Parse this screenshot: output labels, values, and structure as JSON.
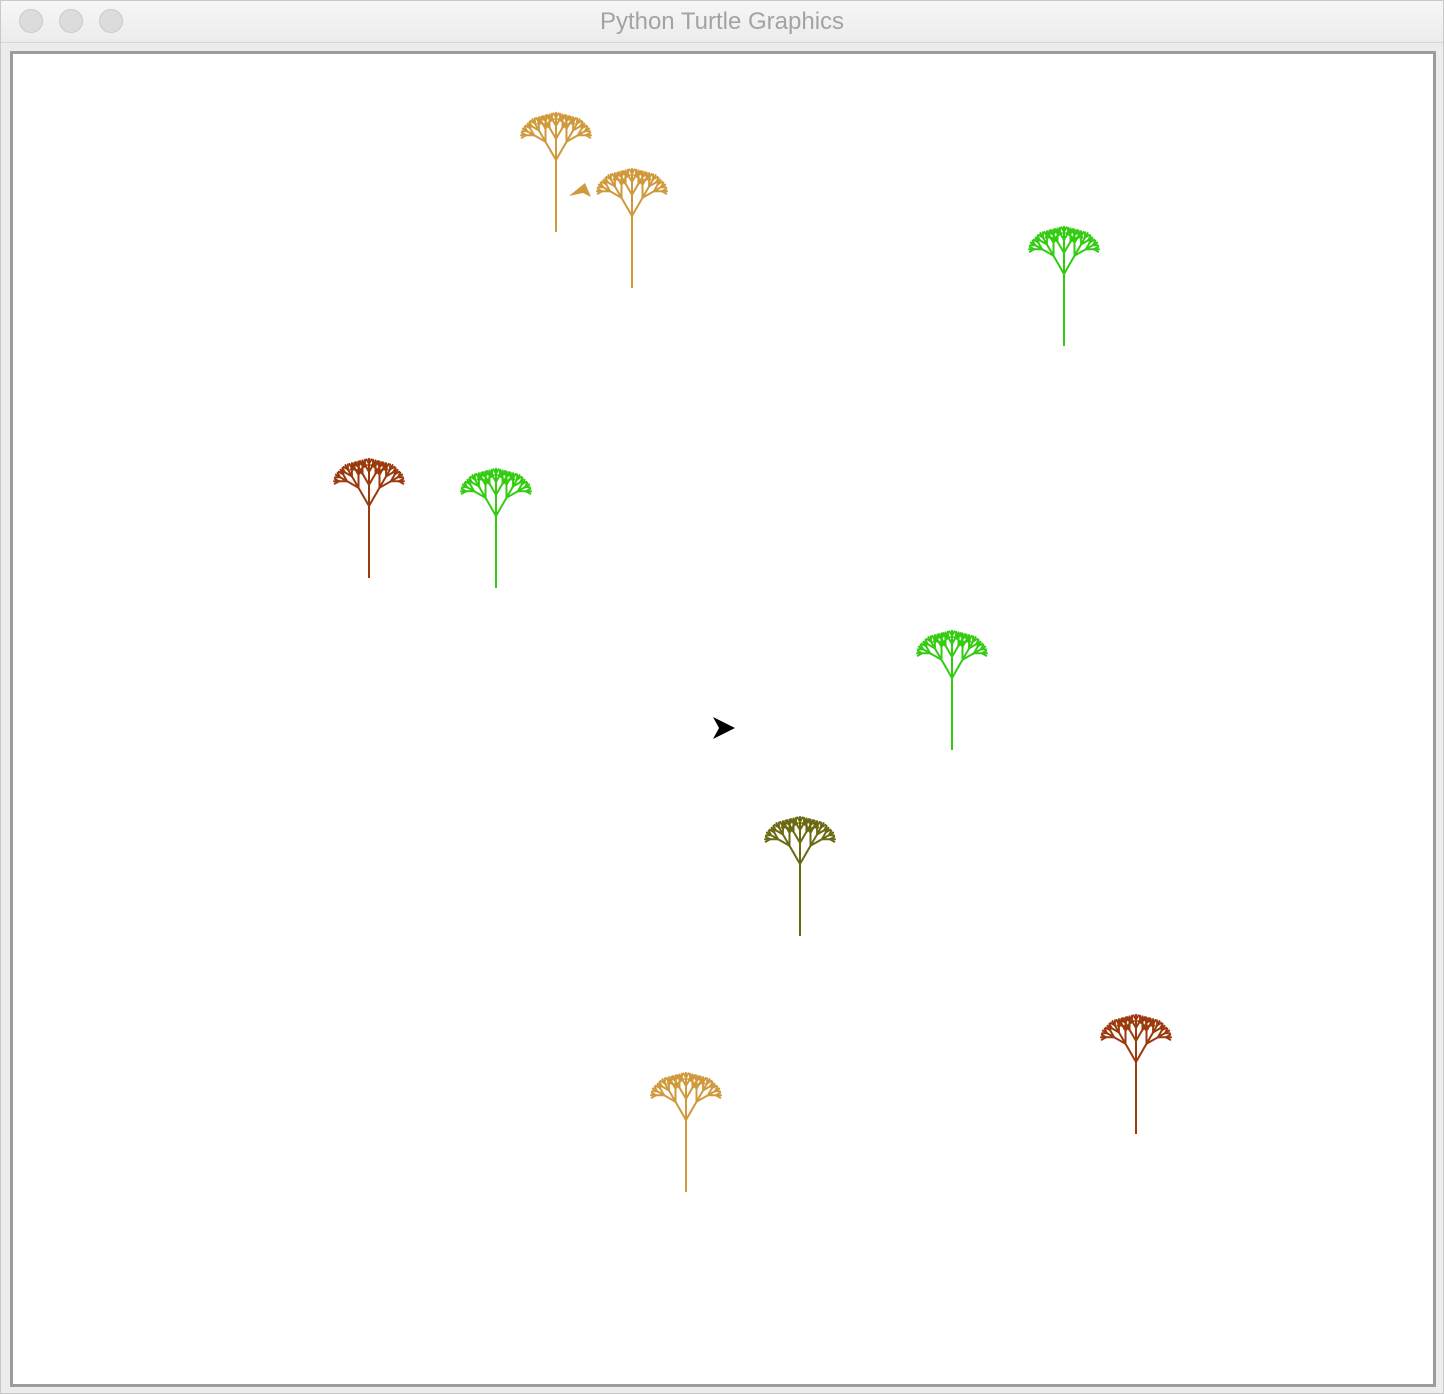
{
  "window": {
    "title": "Python Turtle Graphics"
  },
  "canvas": {
    "background": "#ffffff",
    "turtle_color": "#000000",
    "tree_colors": {
      "tan": "#d09a3c",
      "green": "#33cc11",
      "brown": "#9b3a0c",
      "olive": "#6b6a12"
    },
    "trees": [
      {
        "color": "tan"
      },
      {
        "color": "tan"
      },
      {
        "color": "green"
      },
      {
        "color": "brown"
      },
      {
        "color": "green"
      },
      {
        "color": "green"
      },
      {
        "color": "olive"
      },
      {
        "color": "brown"
      },
      {
        "color": "tan"
      }
    ],
    "icons": {
      "turtle": "turtle-arrow-icon",
      "stamp": "stamp-arrow-icon"
    }
  }
}
